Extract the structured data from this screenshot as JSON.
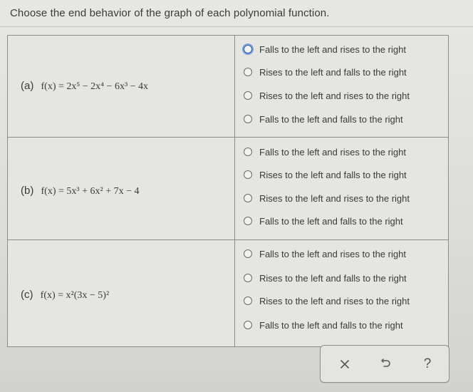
{
  "question": "Choose the end behavior of the graph of each polynomial function.",
  "rows": [
    {
      "label": "(a)",
      "function": "f(x) = 2x⁵ − 2x⁴ − 6x³ − 4x",
      "options": [
        "Falls to the left and rises to the right",
        "Rises to the left and falls to the right",
        "Rises to the left and rises to the right",
        "Falls to the left and falls to the right"
      ]
    },
    {
      "label": "(b)",
      "function": "f(x) = 5x³ + 6x² + 7x − 4",
      "options": [
        "Falls to the left and rises to the right",
        "Rises to the left and falls to the right",
        "Rises to the left and rises to the right",
        "Falls to the left and falls to the right"
      ]
    },
    {
      "label": "(c)",
      "function": "f(x) = x²(3x − 5)²",
      "options": [
        "Falls to the left and rises to the right",
        "Rises to the left and falls to the right",
        "Rises to the left and rises to the right",
        "Falls to the left and falls to the right"
      ]
    }
  ],
  "toolbar": {
    "clear_icon": "close-icon",
    "undo_icon": "undo-icon",
    "help_label": "?"
  },
  "colors": {
    "focus": "#2f5fa8",
    "text": "#3a3a3a",
    "border": "#8c8c8a"
  }
}
